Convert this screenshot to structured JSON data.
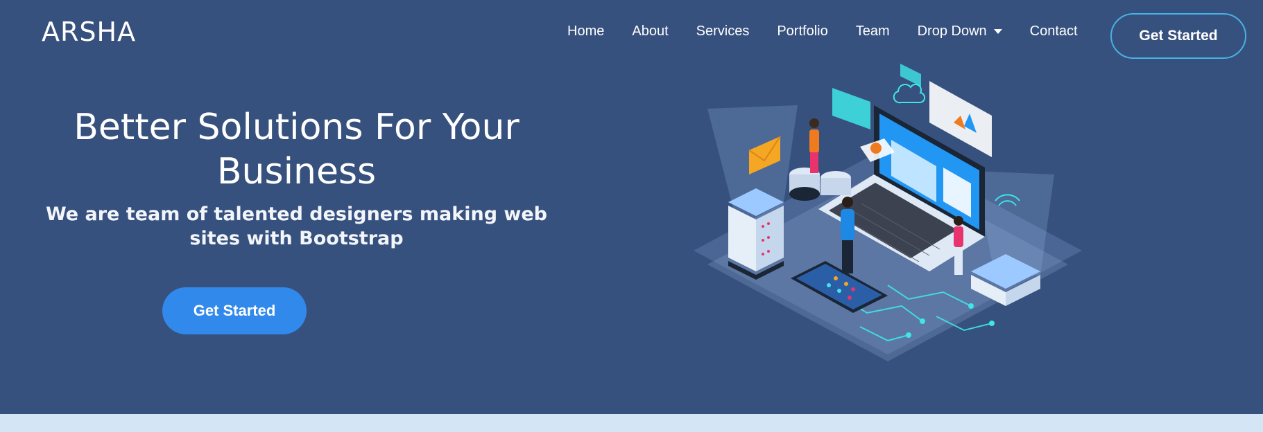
{
  "header": {
    "logo": "ARSHA",
    "nav": [
      {
        "label": "Home"
      },
      {
        "label": "About"
      },
      {
        "label": "Services"
      },
      {
        "label": "Portfolio"
      },
      {
        "label": "Team"
      },
      {
        "label": "Drop Down",
        "icon": "caret-down-icon"
      },
      {
        "label": "Contact"
      }
    ],
    "cta_label": "Get Started"
  },
  "hero": {
    "title": "Better Solutions For Your Business",
    "subtitle": "We are team of talented designers making web sites with Bootstrap",
    "cta_label": "Get Started",
    "illustration": "isometric-tech-illustration"
  },
  "colors": {
    "background": "#37517e",
    "outline_border": "#47b2e4",
    "primary_button": "#3189eb",
    "next_section": "#d4e6f6"
  }
}
